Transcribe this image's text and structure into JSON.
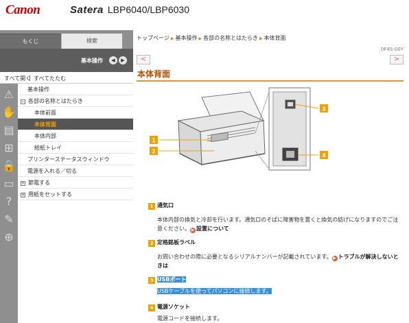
{
  "header": {
    "brand": "Canon",
    "product_line": "Satera",
    "model": "LBP6040/LBP6030"
  },
  "sidebar": {
    "tab_toc": "もくじ",
    "tab_search": "検索",
    "topic_title": "基本操作",
    "expand_all": "すべて開く",
    "separator": "|",
    "collapse_all": "すべてたたむ",
    "items": [
      {
        "label": "基本操作",
        "prefix": ""
      },
      {
        "label": "各部の名称とはたらき",
        "prefix": "−"
      },
      {
        "label": "本体前面",
        "prefix": ""
      },
      {
        "label": "本体背面",
        "prefix": ""
      },
      {
        "label": "本体内部",
        "prefix": ""
      },
      {
        "label": "給紙トレイ",
        "prefix": ""
      },
      {
        "label": "プリンターステータスウィンドウ",
        "prefix": ""
      },
      {
        "label": "電源を入れる／切る",
        "prefix": ""
      },
      {
        "label": "節電する",
        "prefix": "+"
      },
      {
        "label": "用紙をセットする",
        "prefix": "+"
      }
    ]
  },
  "breadcrumb": [
    "トップページ",
    "基本操作",
    "各部の名称とはたらき",
    "本体背面"
  ],
  "doc_id": "0F4S-00Y",
  "nav": {
    "prev": "<",
    "next": ">"
  },
  "page_title": "本体背面",
  "callout_numbers": [
    "1",
    "2",
    "3",
    "4"
  ],
  "parts": [
    {
      "number": "1",
      "title": "通気口",
      "desc": "本体内部の換気と冷却を行います。通気口のそばに障害物を置くと換気の妨げになりますのでご注意ください。",
      "link": "設置について",
      "desc_after": ""
    },
    {
      "number": "2",
      "title": "定格銘板ラベル",
      "desc": "お問い合わせの際に必要となるシリアルナンバーが記載されています。",
      "link": "トラブルが解決しないときは",
      "desc_after": ""
    },
    {
      "number": "3",
      "title": "USBポート",
      "desc": "USBケーブルを使ってパソコンに接続します。",
      "link": "",
      "desc_after": ""
    },
    {
      "number": "4",
      "title": "電源ソケット",
      "desc": "電源コードを接続します。",
      "link": "",
      "desc_after": ""
    }
  ],
  "colors": {
    "accent": "#f0a000",
    "title": "#c24a00",
    "brand": "#cc0000",
    "highlight": "#3a8fd8"
  }
}
